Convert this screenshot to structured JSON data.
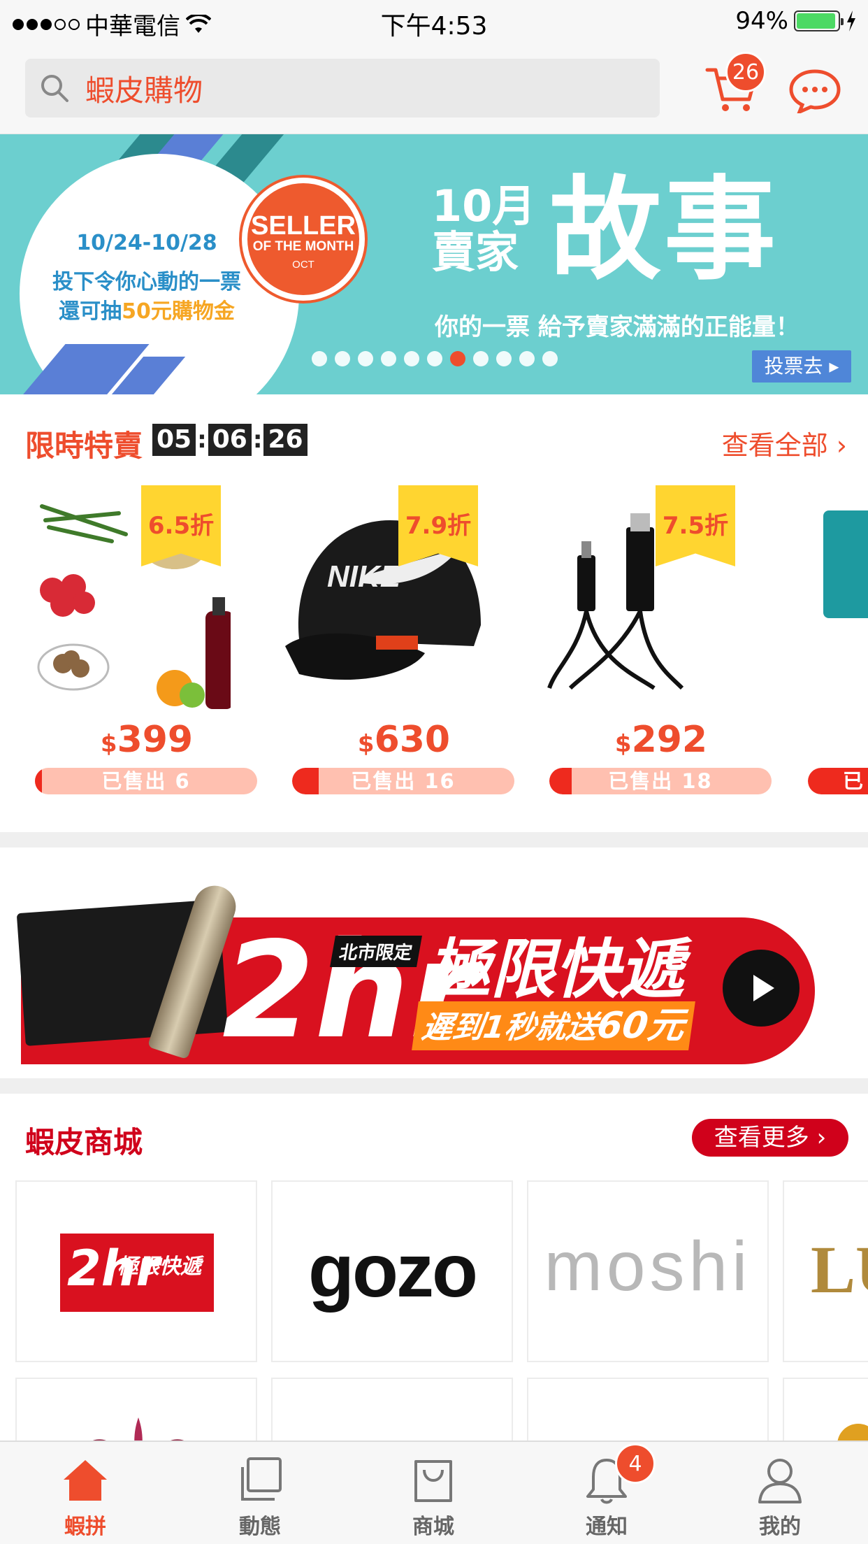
{
  "status_bar": {
    "carrier": "中華電信",
    "time": "下午4:53",
    "battery": "94%"
  },
  "header": {
    "search_placeholder": "蝦皮購物",
    "cart_count": "26"
  },
  "hero_banner": {
    "date_range": "10/24-10/28",
    "line1": "投下令你心動的一票",
    "line2_pre": "還可抽",
    "line2_highlight": "50元購物金",
    "badge_line1": "SELLER",
    "badge_line2": "OF THE MONTH",
    "badge_line3": "OCT",
    "month": "10月",
    "seller_word": "賣家",
    "headline": "故事",
    "tagline": "你的一票 給予賣家滿滿的正能量！",
    "vote_button": "投票去",
    "page_count": 11,
    "active_page": 7
  },
  "flash_sale": {
    "title": "限時特賣",
    "timer": [
      "05",
      "06",
      "26"
    ],
    "see_all": "查看全部",
    "products": [
      {
        "discount": "6.5折",
        "currency": "$",
        "price": "399",
        "sold": "已售出 6",
        "sold_fraction": 0.03
      },
      {
        "discount": "7.9折",
        "currency": "$",
        "price": "630",
        "sold": "已售出 16",
        "sold_fraction": 0.12
      },
      {
        "discount": "7.5折",
        "currency": "$",
        "price": "292",
        "sold": "已售出 18",
        "sold_fraction": 0.1
      },
      {
        "discount": "",
        "currency": "",
        "price": "",
        "sold": "已",
        "sold_fraction": 0.5
      }
    ]
  },
  "promo_banner": {
    "tag": "北市限定",
    "number": "2hr",
    "title": "極限快遞",
    "subtitle_pre": "遲到1秒就送",
    "subtitle_amount": "60元"
  },
  "mall": {
    "title": "蝦皮商城",
    "more": "查看更多",
    "brands": [
      {
        "name": "2hr 極限快遞"
      },
      {
        "name": "gozo"
      },
      {
        "name": "moshi"
      },
      {
        "name": "LU"
      }
    ]
  },
  "tabbar": {
    "tabs": [
      {
        "label": "蝦拼",
        "icon": "home-icon",
        "active": true
      },
      {
        "label": "動態",
        "icon": "feed-icon",
        "active": false
      },
      {
        "label": "商城",
        "icon": "mall-bag-icon",
        "active": false
      },
      {
        "label": "通知",
        "icon": "bell-icon",
        "active": false,
        "badge": "4"
      },
      {
        "label": "我的",
        "icon": "profile-icon",
        "active": false
      }
    ]
  },
  "colors": {
    "brand": "#ee4d2d",
    "mall_red": "#d0011b",
    "banner_teal": "#6ccfcf",
    "discount_yellow": "#ffd530"
  }
}
